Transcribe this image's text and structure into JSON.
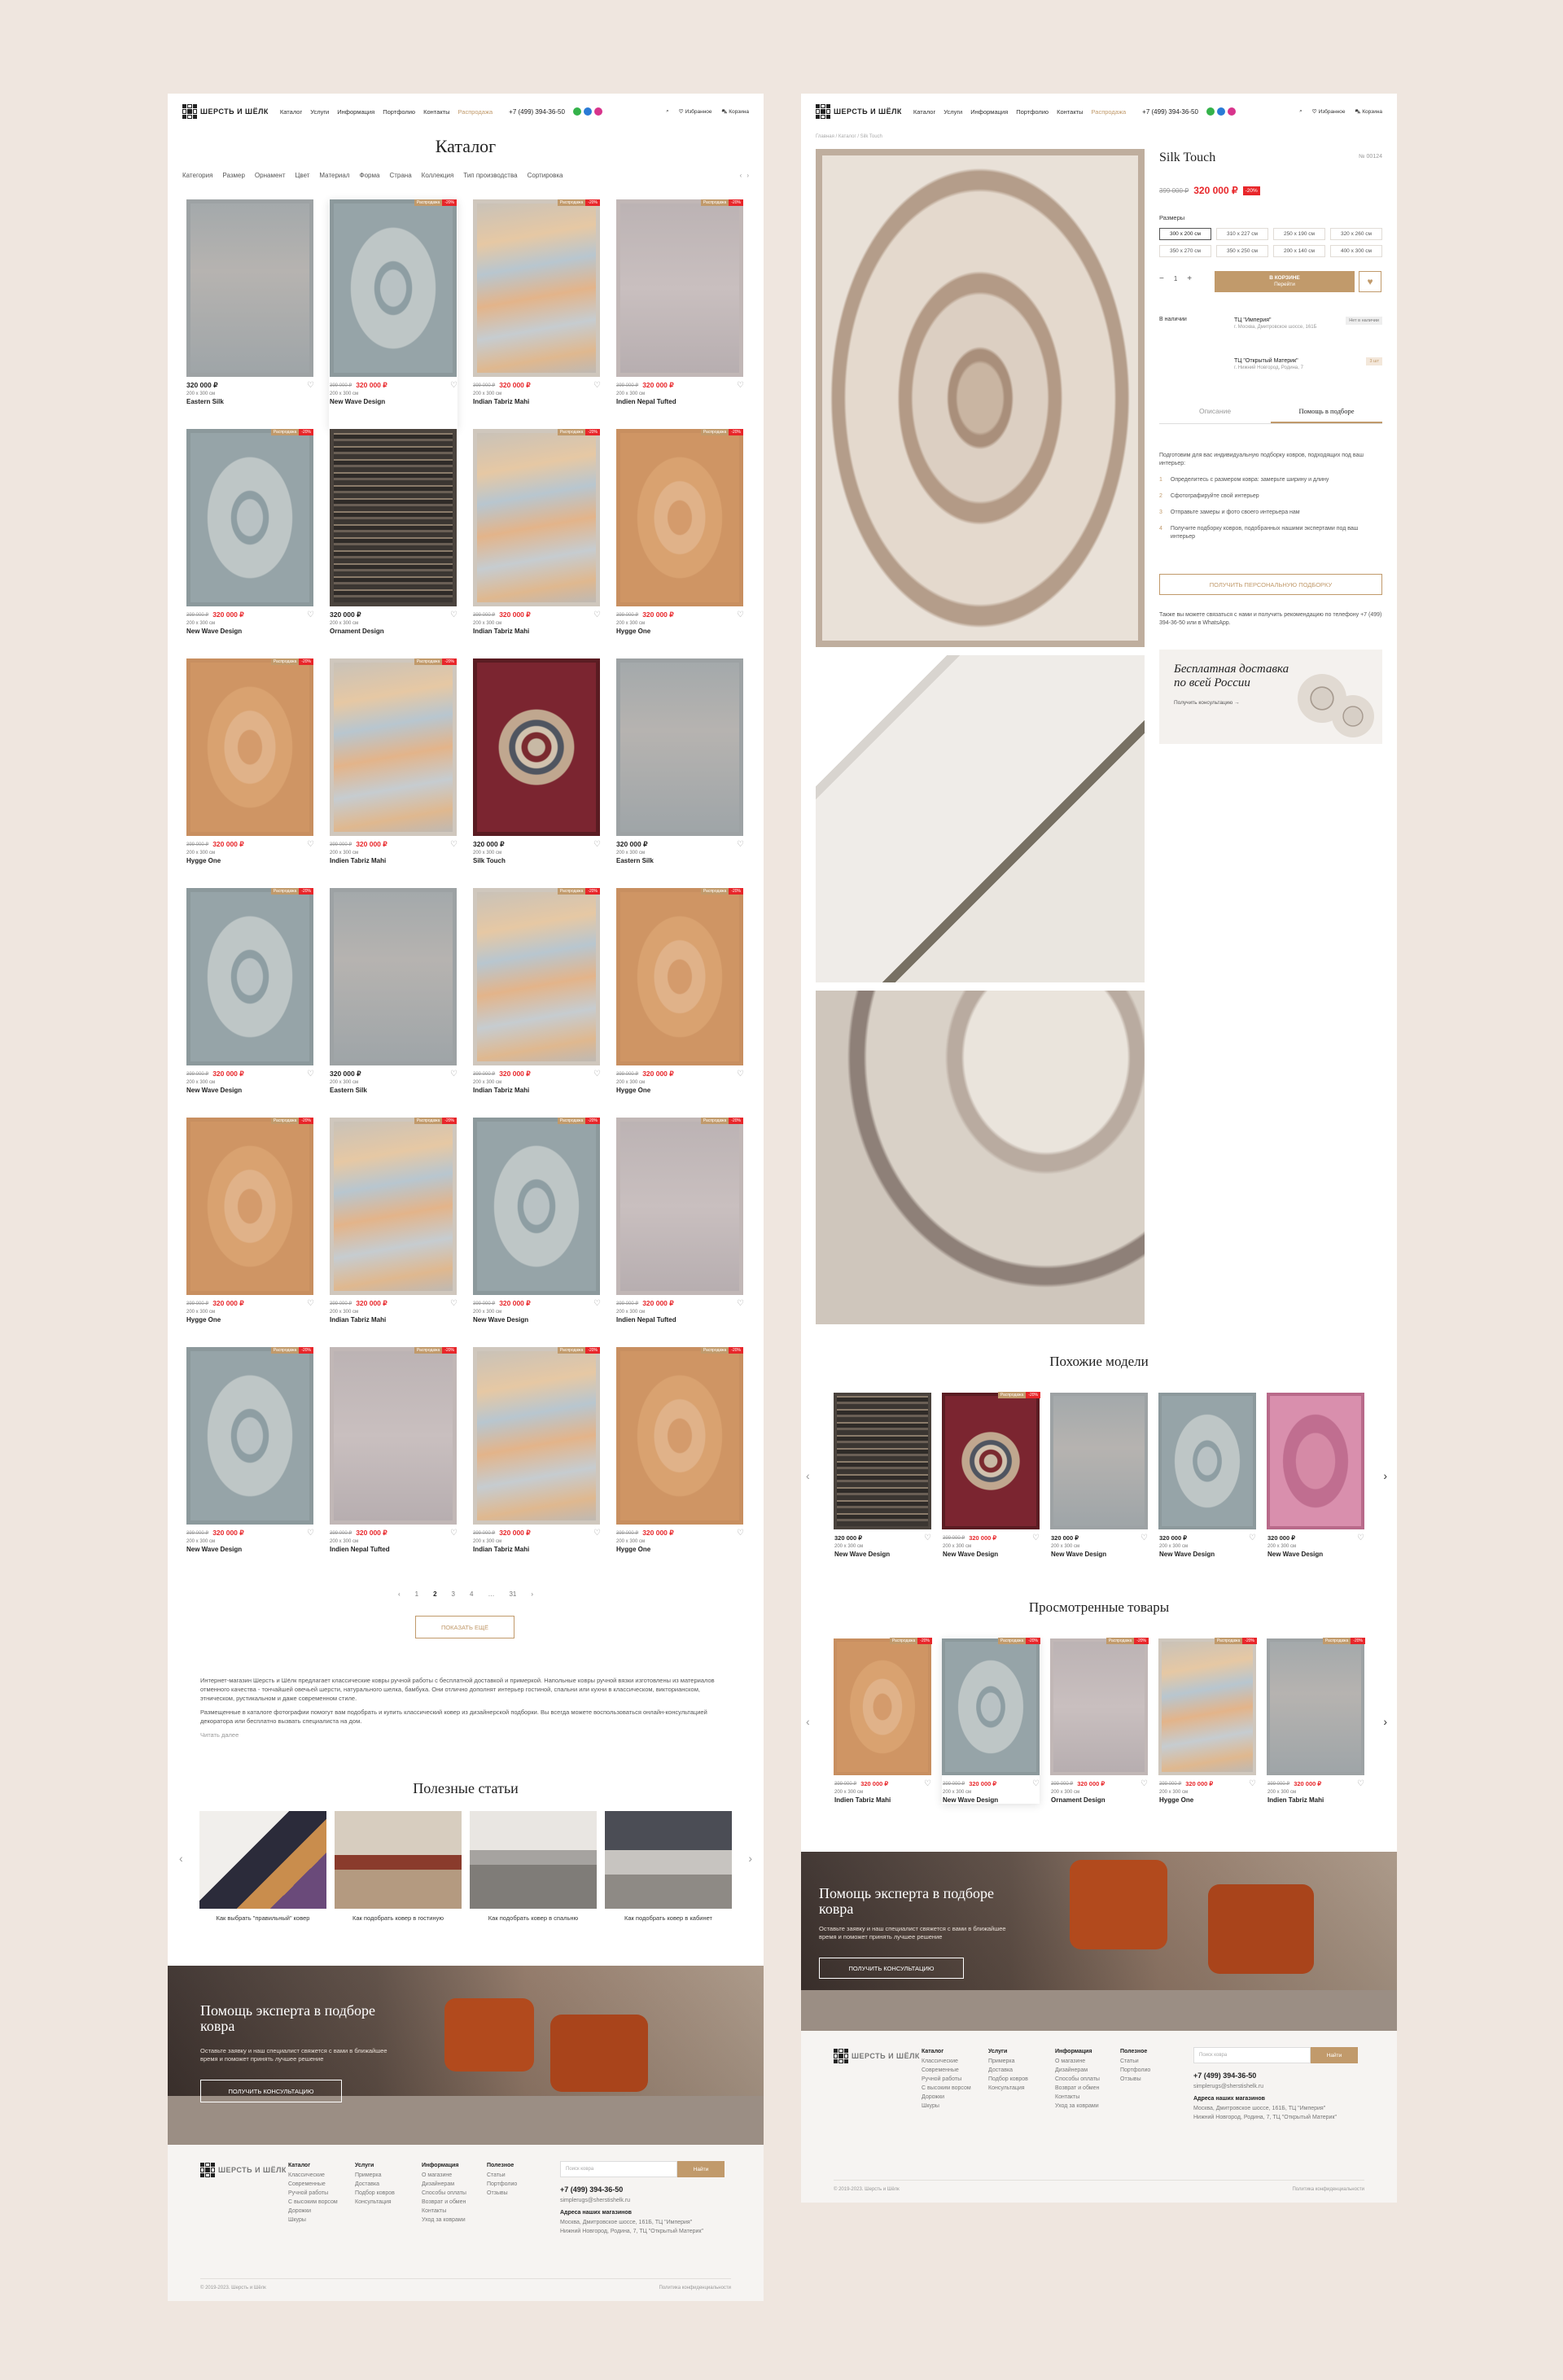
{
  "catalog": {
    "header": {
      "logo": "ШЕРСТЬ И ШЁЛК",
      "nav": [
        "Каталог",
        "Услуги",
        "Информация",
        "Портфолио",
        "Контакты",
        "Распродажа"
      ],
      "phone": "+7 (499) 394-36-50",
      "favorites": "Избранное",
      "cart": "Корзина"
    },
    "title": "Каталог",
    "filters": [
      "Категория",
      "Размер",
      "Орнамент",
      "Цвет",
      "Материал",
      "Форма",
      "Страна",
      "Коллекция",
      "Тип производства",
      "Сортировка"
    ],
    "badge_label": "Распродажа",
    "badge_discount": "-20%",
    "products": [
      {
        "name": "Eastern Silk",
        "price": "320 000 ₽",
        "old": "",
        "size": "200 x 300 см",
        "style": "gray",
        "sale": false
      },
      {
        "name": "New Wave Design",
        "price": "320 000 ₽",
        "old": "399 000 ₽",
        "size": "200 x 300 см",
        "style": "blue",
        "sale": true
      },
      {
        "name": "Indian Tabriz Mahi",
        "price": "320 000 ₽",
        "old": "399 000 ₽",
        "size": "200 x 300 см",
        "style": "abstract",
        "sale": true
      },
      {
        "name": "Indien Nepal Tufted",
        "price": "320 000 ₽",
        "old": "399 000 ₽",
        "size": "200 x 300 см",
        "style": "lilac",
        "sale": true
      },
      {
        "name": "New Wave Design",
        "price": "320 000 ₽",
        "old": "399 000 ₽",
        "size": "200 x 300 см",
        "style": "blue",
        "sale": true
      },
      {
        "name": "Ornament Design",
        "price": "320 000 ₽",
        "old": "",
        "size": "200 x 300 см",
        "style": "tribal",
        "sale": false
      },
      {
        "name": "Indian Tabriz Mahi",
        "price": "320 000 ₽",
        "old": "399 000 ₽",
        "size": "200 x 300 см",
        "style": "abstract",
        "sale": true
      },
      {
        "name": "Hygge One",
        "price": "320 000 ₽",
        "old": "399 000 ₽",
        "size": "200 x 300 см",
        "style": "orange",
        "sale": true
      },
      {
        "name": "Hygge One",
        "price": "320 000 ₽",
        "old": "399 000 ₽",
        "size": "200 x 300 см",
        "style": "orange",
        "sale": true
      },
      {
        "name": "Indien Tabriz Mahi",
        "price": "320 000 ₽",
        "old": "399 000 ₽",
        "size": "200 x 300 см",
        "style": "abstract",
        "sale": true
      },
      {
        "name": "Silk Touch",
        "price": "320 000 ₽",
        "old": "",
        "size": "200 x 300 см",
        "style": "red",
        "sale": false
      },
      {
        "name": "Eastern Silk",
        "price": "320 000 ₽",
        "old": "",
        "size": "200 x 300 см",
        "style": "gray",
        "sale": false
      },
      {
        "name": "New Wave Design",
        "price": "320 000 ₽",
        "old": "399 000 ₽",
        "size": "200 x 300 см",
        "style": "blue",
        "sale": true
      },
      {
        "name": "Eastern Silk",
        "price": "320 000 ₽",
        "old": "",
        "size": "200 x 300 см",
        "style": "gray",
        "sale": false
      },
      {
        "name": "Indian Tabriz Mahi",
        "price": "320 000 ₽",
        "old": "399 000 ₽",
        "size": "200 x 300 см",
        "style": "abstract",
        "sale": true
      },
      {
        "name": "Hygge One",
        "price": "320 000 ₽",
        "old": "399 000 ₽",
        "size": "200 x 300 см",
        "style": "orange",
        "sale": true
      },
      {
        "name": "Hygge One",
        "price": "320 000 ₽",
        "old": "399 000 ₽",
        "size": "200 x 300 см",
        "style": "orange",
        "sale": true
      },
      {
        "name": "Indian Tabriz Mahi",
        "price": "320 000 ₽",
        "old": "399 000 ₽",
        "size": "200 x 300 см",
        "style": "abstract",
        "sale": true
      },
      {
        "name": "New Wave Design",
        "price": "320 000 ₽",
        "old": "399 000 ₽",
        "size": "200 x 300 см",
        "style": "blue",
        "sale": true
      },
      {
        "name": "Indien Nepal Tufted",
        "price": "320 000 ₽",
        "old": "399 000 ₽",
        "size": "200 x 300 см",
        "style": "lilac",
        "sale": true
      },
      {
        "name": "New Wave Design",
        "price": "320 000 ₽",
        "old": "399 000 ₽",
        "size": "200 x 300 см",
        "style": "blue",
        "sale": true
      },
      {
        "name": "Indien Nepal Tufted",
        "price": "320 000 ₽",
        "old": "399 000 ₽",
        "size": "200 x 300 см",
        "style": "lilac",
        "sale": true
      },
      {
        "name": "Indian Tabriz Mahi",
        "price": "320 000 ₽",
        "old": "399 000 ₽",
        "size": "200 x 300 см",
        "style": "abstract",
        "sale": true
      },
      {
        "name": "Hygge One",
        "price": "320 000 ₽",
        "old": "399 000 ₽",
        "size": "200 x 300 см",
        "style": "orange",
        "sale": true
      }
    ],
    "pager": [
      "‹",
      "1",
      "2",
      "3",
      "4",
      "…",
      "31",
      "›"
    ],
    "pager_current": "2",
    "show_more": "Показать ещё",
    "seo": [
      "Интернет-магазин Шерсть и Шёлк предлагает классические ковры ручной работы с бесплатной доставкой и примеркой. Напольные ковры ручной вязки изготовлены из материалов отменного качества - тончайшей овечьей шерсти, натурального шелка, бамбука. Они отлично дополнят интерьер гостиной, спальни или кухни в классическом, викторианском, этническом, рустикальном и даже современном стиле.",
      "Размещенные в каталоге фотографии помогут вам подобрать и купить классический ковер из дизайнерской подборки. Вы всегда можете воспользоваться онлайн-консультацией декоратора или бесплатно вызвать специалиста на дом."
    ],
    "seo_more": "Читать далее",
    "articles_title": "Полезные статьи",
    "articles": [
      "Как выбрать \"правильный\" ковер",
      "Как подобрать ковер в гостиную",
      "Как подобрать ковер в спальню",
      "Как подобрать ковер в кабинет"
    ],
    "banner": {
      "title": "Помощь эксперта в подборе ковра",
      "text": "Оставьте заявку и наш специалист свяжется с вами в ближайшее время и поможет принять лучшее решение",
      "button": "Получить консультацию"
    }
  },
  "footer": {
    "cols": [
      {
        "title": "Каталог",
        "items": [
          "Классические",
          "Современные",
          "Ручной работы",
          "С высоким ворсом",
          "Дорожки",
          "Шкуры"
        ]
      },
      {
        "title": "Услуги",
        "items": [
          "Примерка",
          "Доставка",
          "Подбор ковров",
          "Консультация"
        ]
      },
      {
        "title": "Информация",
        "items": [
          "О магазине",
          "Дизайнерам",
          "Способы оплаты",
          "Возврат и обмен",
          "Контакты",
          "Уход за коврами"
        ]
      },
      {
        "title": "Полезное",
        "items": [
          "Статьи",
          "Портфолио",
          "Отзывы"
        ]
      }
    ],
    "search_placeholder": "Поиск ковра",
    "search_button": "Найти",
    "phone": "+7 (499) 394-36-50",
    "email": "simplerugs@sherstishelk.ru",
    "addresses_title": "Адреса наших магазинов",
    "addresses": [
      "Москва, Дмитровское шоссе, 161Б, ТЦ \"Империя\"",
      "Нижний Новгород, Родина, 7, ТЦ \"Открытый Материк\""
    ],
    "copyright": "© 2019-2023. Шерсть и Шёлк",
    "policy": "Политика конфиденциальности"
  },
  "product": {
    "breadcrumb": "Главная / Каталог / Silk Touch",
    "name": "Silk Touch",
    "article": "№ 00124",
    "old_price": "399 000 ₽",
    "price": "320 000 ₽",
    "discount": "-20%",
    "sizes_label": "Размеры",
    "sizes": [
      "300 x 200 см",
      "310 x 227 см",
      "250 x 190 см",
      "320 x 260 см",
      "350 x 270 см",
      "350 x 250 см",
      "200 x 140 см",
      "400 x 300 см"
    ],
    "selected_size": "300 x 200 см",
    "qty": "1",
    "cart_button": "В корзине",
    "cart_sub": "Перейти",
    "stock_label": "В наличии",
    "stores": [
      {
        "name": "ТЦ \"Империя\"",
        "addr": "г. Москва, Дмитровское шоссе, 161Б",
        "tag": "Нет в наличии"
      },
      {
        "name": "ТЦ \"Открытый Материк\"",
        "addr": "г. Нижний Новгород, Родина, 7",
        "tag": "3 шт"
      }
    ],
    "tabs": [
      "Описание",
      "Помощь в подборе"
    ],
    "active_tab": "Помощь в подборе",
    "help_intro": "Подготовим для вас индивидуальную подборку ковров, подходящих под ваш интерьер:",
    "help_steps": [
      "Определитесь с размером ковра: замерьте ширину и длину",
      "Сфотографируйте свой интерьер",
      "Отправьте замеры и фото своего интерьера нам",
      "Получите подборку ковров, подобранных нашими экспертами под ваш интерьер"
    ],
    "help_button": "Получить персональную подборку",
    "help_contact": "Также вы можете связаться с нами и получить рекомендацию по телефону +7 (499) 394-36-50 или в WhatsApp.",
    "promo_title": "Бесплатная доставка по всей России",
    "promo_link": "Получить консультацию →",
    "similar_title": "Похожие модели",
    "similar": [
      {
        "name": "New Wave Design",
        "price": "320 000 ₽",
        "old": "",
        "size": "200 x 300 см",
        "style": "tribal",
        "sale": false
      },
      {
        "name": "New Wave Design",
        "price": "320 000 ₽",
        "old": "399 000 ₽",
        "size": "200 x 300 см",
        "style": "red",
        "sale": true
      },
      {
        "name": "New Wave Design",
        "price": "320 000 ₽",
        "old": "",
        "size": "200 x 300 см",
        "style": "gray",
        "sale": false
      },
      {
        "name": "New Wave Design",
        "price": "320 000 ₽",
        "old": "",
        "size": "200 x 300 см",
        "style": "blue",
        "sale": false
      },
      {
        "name": "New Wave Design",
        "price": "320 000 ₽",
        "old": "",
        "size": "200 x 300 см",
        "style": "pink",
        "sale": false
      }
    ],
    "viewed_title": "Просмотренные товары",
    "viewed": [
      {
        "name": "Indien Tabriz Mahi",
        "price": "320 000 ₽",
        "old": "399 000 ₽",
        "size": "200 x 300 см",
        "style": "orange",
        "sale": true
      },
      {
        "name": "New Wave Design",
        "price": "320 000 ₽",
        "old": "399 000 ₽",
        "size": "200 x 300 см",
        "style": "blue",
        "sale": true
      },
      {
        "name": "Ornament Design",
        "price": "320 000 ₽",
        "old": "399 000 ₽",
        "size": "200 x 300 см",
        "style": "lilac",
        "sale": true
      },
      {
        "name": "Hygge One",
        "price": "320 000 ₽",
        "old": "399 000 ₽",
        "size": "200 x 300 см",
        "style": "abstract",
        "sale": true
      },
      {
        "name": "Indien Tabriz Mahi",
        "price": "320 000 ₽",
        "old": "399 000 ₽",
        "size": "200 x 300 см",
        "style": "gray",
        "sale": true
      }
    ]
  },
  "colors": {
    "accent": "#c19a6b",
    "sale": "#e8262a",
    "background": "#efe6df"
  }
}
